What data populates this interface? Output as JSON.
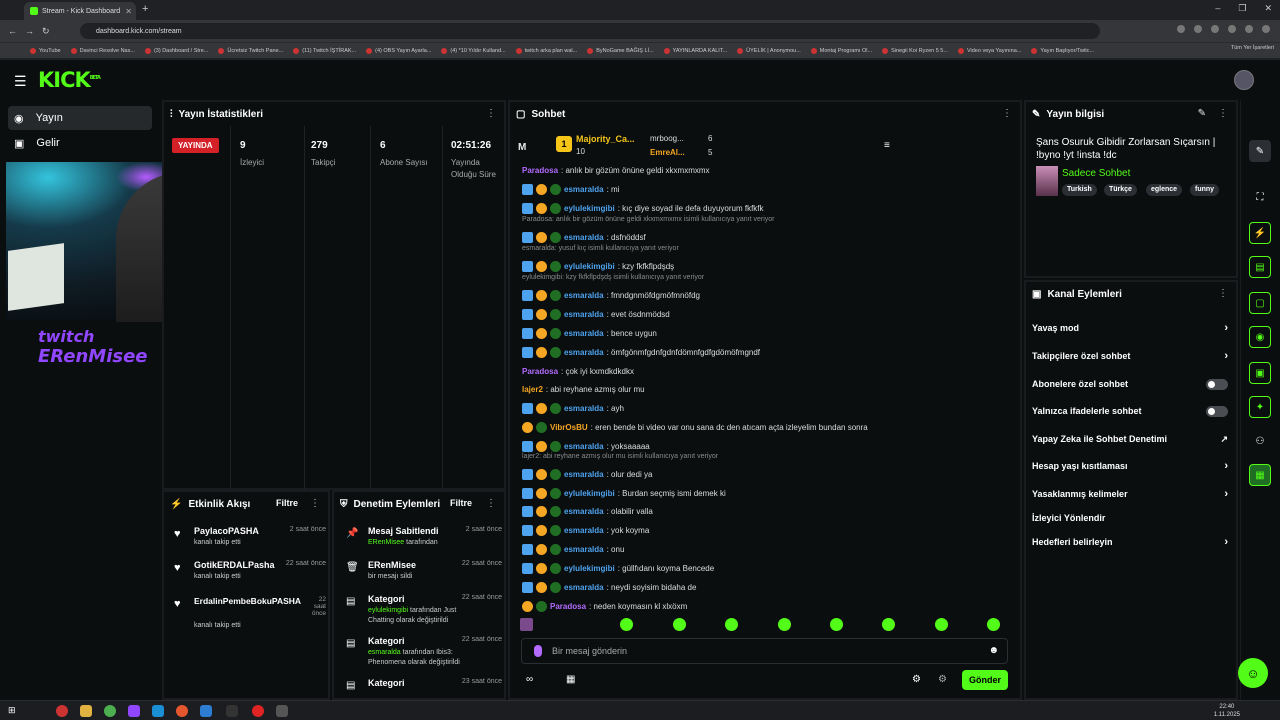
{
  "browser": {
    "tab_title": "Stream - Kick Dashboard",
    "url": "dashboard.kick.com/stream",
    "bookmarks": [
      "YouTube",
      "Davinci Resolve Nas...",
      "(3) Dashboard / Stre...",
      "Ücretsiz Twitch Pane...",
      "(11) Twitch İŞTİRAK...",
      "(4) OBS Yayın Ayarla...",
      "(4) *10 Yıldır Kulland...",
      "twitch arka plan wal...",
      "ByNoGame BAĞIŞ Lİ...",
      "YAYINLARDA KALIT...",
      "ÜYELİK | Anonymou...",
      "Montaj Programı Ol...",
      "Sinegii Koi Ryzen 5 5...",
      "Video veya Yayınına...",
      "Yayın Başlıyor/Twitc..."
    ],
    "bookmarks_right": "Tüm Yer İşaretleri"
  },
  "sidebar": {
    "items": [
      {
        "label": "Yayın",
        "icon": "broadcast-icon"
      },
      {
        "label": "Gelir",
        "icon": "income-icon"
      }
    ]
  },
  "overlay": {
    "line1": "twitch",
    "line2": "ERenMisee"
  },
  "stats": {
    "title": "Yayın İstatistikleri",
    "live": "YAYINDA",
    "items": [
      {
        "value": "9",
        "label": "İzleyici"
      },
      {
        "value": "279",
        "label": "Takipçi"
      },
      {
        "value": "6",
        "label": "Abone Sayısı"
      },
      {
        "value": "02:51:26",
        "label": "Yayında Olduğu Süre"
      }
    ]
  },
  "activity": {
    "title": "Etkinlik Akışı",
    "filter": "Filtre",
    "items": [
      {
        "name": "PaylacoPASHA",
        "time": "2 saat önce",
        "desc": "kanalı takip etti"
      },
      {
        "name": "GotikERDALPasha",
        "time": "22 saat önce",
        "desc": "kanalı takip etti"
      },
      {
        "name": "ErdalinPembeBokuPASHA",
        "time": "22 saat önce",
        "desc": "kanalı takip etti"
      }
    ]
  },
  "moderation": {
    "title": "Denetim Eylemleri",
    "filter": "Filtre",
    "items": [
      {
        "name": "Mesaj Sabitlendi",
        "time": "2 saat önce",
        "user": "ERenMisee",
        "desc": " tarafından",
        "icon": "pin-icon"
      },
      {
        "name": "ERenMisee",
        "time": "22 saat önce",
        "user": "",
        "desc": "bir mesajı sildi",
        "icon": "trash-icon"
      },
      {
        "name": "Kategori",
        "time": "22 saat önce",
        "user": "eylulekimgibi",
        "desc": " tarafından Just Chatting olarak değiştirildi",
        "icon": "category-icon"
      },
      {
        "name": "Kategori",
        "time": "22 saat önce",
        "user": "esmaralda",
        "desc": " tarafından Ibis3: Phenomena olarak değiştirildi",
        "icon": "category-icon"
      },
      {
        "name": "Kategori",
        "time": "23 saat önce",
        "user": "",
        "desc": "",
        "icon": "category-icon"
      }
    ]
  },
  "chat": {
    "title": "Sohbet",
    "pinned": {
      "initial": "M",
      "rank": "1",
      "user1": "Majority_Ca...",
      "count1": "10",
      "user2": "mrboog...",
      "count2": "6",
      "user3": "EmreAl...",
      "count3": "5"
    },
    "messages": [
      {
        "user": "Paradosa",
        "text": ": anlık bir gözüm önüne geldi xkxmxmxmx",
        "color": "#b36cff",
        "badges": ""
      },
      {
        "user": "esmaralda",
        "text": ": mi",
        "color": "#4ea3ef",
        "badges": "msg"
      },
      {
        "user": "eylulekimgibi",
        "text": ": kıç diye soyad ile defa duyuyorum fkfkfk",
        "color": "#4ea3ef",
        "badges": "msg"
      },
      {
        "user": "esmaralda",
        "text": ": dsfnöddsf",
        "color": "#4ea3ef",
        "badges": "msg"
      },
      {
        "user": "eylulekimgibi",
        "text": ": kzy fkfkflpdşdş",
        "color": "#4ea3ef",
        "badges": "msg"
      },
      {
        "user": "esmaralda",
        "text": ": fmndgnmöfdgmöfmnöfdg",
        "color": "#4ea3ef",
        "badges": "msg"
      },
      {
        "user": "esmaralda",
        "text": ": evet ösdnmödsd",
        "color": "#4ea3ef",
        "badges": "msg"
      },
      {
        "user": "esmaralda",
        "text": ": bence uygun",
        "color": "#4ea3ef",
        "badges": "msg"
      },
      {
        "user": "esmaralda",
        "text": ": ömfgönmfgdnfgdnfdömnfgdfgdömöfmgndf",
        "color": "#4ea3ef",
        "badges": "msg"
      },
      {
        "user": "Paradosa",
        "text": ": çok iyi kxmdkdkdkx",
        "color": "#b36cff",
        "badges": ""
      },
      {
        "user": "lajer2",
        "text": ": abi reyhane azmış olur mu",
        "color": "#f5a623",
        "badges": "none"
      },
      {
        "user": "esmaralda",
        "text": ": ayh",
        "color": "#4ea3ef",
        "badges": "msg"
      },
      {
        "user": "VibrOsBU",
        "text": ": eren bende bi video var onu sana dc den atıcam açta izleyelim bundan sonra",
        "color": "#f5a623",
        "badges": "sub"
      },
      {
        "user": "esmaralda",
        "text": ": yoksaaaaa",
        "color": "#4ea3ef",
        "badges": "msg"
      },
      {
        "user": "esmaralda",
        "text": ": olur dedi ya",
        "color": "#4ea3ef",
        "badges": "msg"
      },
      {
        "user": "eylulekimgibi",
        "text": ": Burdan seçmiş ismi demek ki",
        "color": "#4ea3ef",
        "badges": "msg"
      },
      {
        "user": "esmaralda",
        "text": ": olabilir valla",
        "color": "#4ea3ef",
        "badges": "msg"
      },
      {
        "user": "esmaralda",
        "text": ": yok koyma",
        "color": "#4ea3ef",
        "badges": "msg"
      },
      {
        "user": "esmaralda",
        "text": ": onu",
        "color": "#4ea3ef",
        "badges": "msg"
      },
      {
        "user": "eylulekimgibi",
        "text": ": güllfıdanı koyma Bencede",
        "color": "#4ea3ef",
        "badges": "msg"
      },
      {
        "user": "esmaralda",
        "text": ": neydi soyisim bidaha de",
        "color": "#4ea3ef",
        "badges": "msg"
      },
      {
        "user": "Paradosa",
        "text": ": neden koymasın kl xlxöxm",
        "color": "#b36cff",
        "badges": "sub"
      }
    ],
    "replies": [
      "Paradosa: anlık bir gözüm önüne geldi xkxmxmxmx isimli kullanıcıya yanıt veriyor",
      "esmaralda: yusuf kıç isimli kullanıcıya yanıt veriyor",
      "eylulekimgibi: kzy fkfkflpdşdş isimli kullanıcıya yanıt veriyor",
      "lajer2: abi reyhane azmış olur mu isimli kullanıcıya yanıt veriyor"
    ],
    "input_placeholder": "Bir mesaj gönderin",
    "send": "Gönder"
  },
  "info": {
    "title": "Yayın bilgisi",
    "stream_title": "Şans Osuruk Gibidir Zorlarsan Sıçarsın | !byno !yt !insta !dc",
    "category": "Sadece Sohbet",
    "tags": [
      "Turkish",
      "Türkçe",
      "eglence",
      "funny"
    ]
  },
  "channel_actions": {
    "title": "Kanal Eylemleri",
    "items": [
      {
        "label": "Yavaş mod",
        "control": "chevron"
      },
      {
        "label": "Takipçilere özel sohbet",
        "control": "chevron"
      },
      {
        "label": "Abonelere özel sohbet",
        "control": "toggle"
      },
      {
        "label": "Yalnızca ifadelerle sohbet",
        "control": "toggle"
      },
      {
        "label": "Yapay Zeka ile Sohbet Denetimi",
        "control": "external"
      },
      {
        "label": "Hesap yaşı kısıtlaması",
        "control": "chevron"
      },
      {
        "label": "Yasaklanmış kelimeler",
        "control": "chevron"
      },
      {
        "label": "İzleyici Yönlendir",
        "control": "none"
      },
      {
        "label": "Hedefleri belirleyin",
        "control": "chevron"
      }
    ]
  },
  "clock": {
    "time": "22:40",
    "date": "1.11.2025"
  },
  "colors": {
    "accent": "#53fc18",
    "live": "#d42027"
  }
}
